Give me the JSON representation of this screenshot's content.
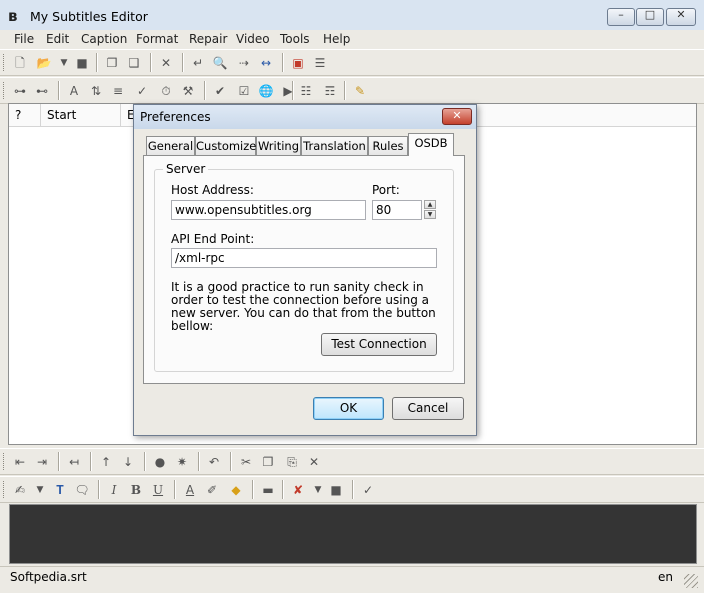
{
  "window": {
    "title": "My Subtitles Editor"
  },
  "menu": [
    "File",
    "Edit",
    "Caption",
    "Format",
    "Repair",
    "Video",
    "Tools",
    "Help"
  ],
  "grid": {
    "columns": [
      "?",
      "Start",
      "E"
    ]
  },
  "status": {
    "file": "Softpedia.srt",
    "language": "en"
  },
  "dialog": {
    "title": "Preferences",
    "tabs": [
      "General",
      "Customize",
      "Writing",
      "Translation",
      "Rules",
      "OSDB"
    ],
    "group_title": "Server",
    "host_label": "Host Address:",
    "host_value": "www.opensubtitles.org",
    "port_label": "Port:",
    "port_value": "80",
    "api_label": "API End Point:",
    "api_value": "/xml-rpc",
    "description": "It is a good practice to run sanity check in order to test the connection before using a new server. You can do that from the button bellow:",
    "test_button": "Test Connection",
    "ok_button": "OK",
    "cancel_button": "Cancel"
  }
}
